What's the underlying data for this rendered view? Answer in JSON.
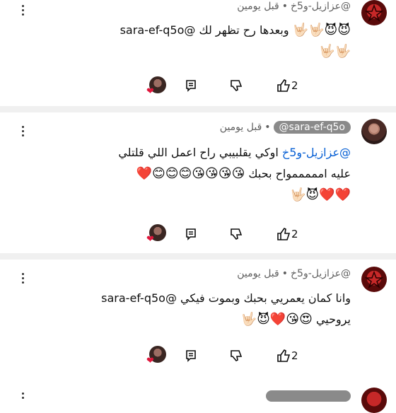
{
  "comments": [
    {
      "author": "@عزازيل-و5خ",
      "time": "قبل يومين",
      "line1_mention": "@sara-ef-q5o",
      "line1_text": "وبعدها رح تظهر لك",
      "line1_emoji": "😈😈🤟🏻🤟🏻",
      "line2_emoji": "🤟🏻🤟🏻",
      "likes": "2"
    },
    {
      "author": "@sara-ef-q5o",
      "time": "قبل يومين",
      "line1_mention": "@عزازيل-و5خ",
      "line1_text": "اوكي يقلبيبي راح اعمل اللي قلتلي",
      "line2_text": "عليه امممممواح بحبك",
      "line2_emoji": "😘😘😘😘😊😊😊❤️",
      "line3_emoji": "❤️❤️😈🤟🏻",
      "likes": "2"
    },
    {
      "author": "@عزازيل-و5خ",
      "time": "قبل يومين",
      "line1_text": "وانا كمان يعمريي بحبك وبموت فيكي",
      "line1_mention": "@sara-ef-q5o",
      "line2_text": "يروحيي",
      "line2_emoji": "😍😘❤️😈🤟🏻",
      "likes": "2"
    }
  ],
  "icons": {
    "like": "thumbs-up-icon",
    "dislike": "thumbs-down-icon",
    "reply": "reply-icon",
    "more": "more-vertical-icon",
    "heart": "creator-heart-icon"
  },
  "colors": {
    "mention": "#065fd4",
    "meta": "#606060",
    "divider": "#f0f0f0",
    "heart": "#e0163b"
  }
}
